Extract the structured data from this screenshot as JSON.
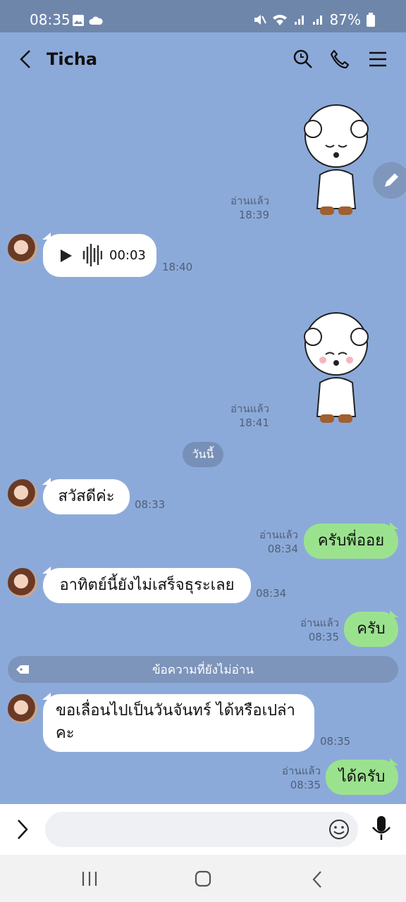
{
  "status_bar": {
    "time": "08:35",
    "battery": "87%"
  },
  "header": {
    "title": "Ticha"
  },
  "messages": {
    "m1_read": "อ่านแล้ว",
    "m1_time": "18:39",
    "m2_voice_duration": "00:03",
    "m2_time": "18:40",
    "m3_read": "อ่านแล้ว",
    "m3_time": "18:41",
    "date_divider": "วันนี้",
    "m4_text": "สวัสดีค่ะ",
    "m4_time": "08:33",
    "m5_read": "อ่านแล้ว",
    "m5_time": "08:34",
    "m5_text": "ครับพี่ออย",
    "m6_text": "อาทิตย์นี้ยังไม่เสร็จธุระเลย",
    "m6_time": "08:34",
    "m7_read": "อ่านแล้ว",
    "m7_time": "08:35",
    "m7_text": "ครับ",
    "unread_divider": "ข้อความที่ยังไม่อ่าน",
    "m8_line1": "ขอเลื่อนไปเป็นวันจันทร์ ได้หรือเปล่า",
    "m8_line2": "คะ",
    "m8_time": "08:35",
    "m9_read": "อ่านแล้ว",
    "m9_time": "08:35",
    "m9_text": "ได้ครับ"
  },
  "colors": {
    "chat_bg": "#8caad9",
    "outgoing_bubble": "#9be28f",
    "incoming_bubble": "#ffffff"
  }
}
